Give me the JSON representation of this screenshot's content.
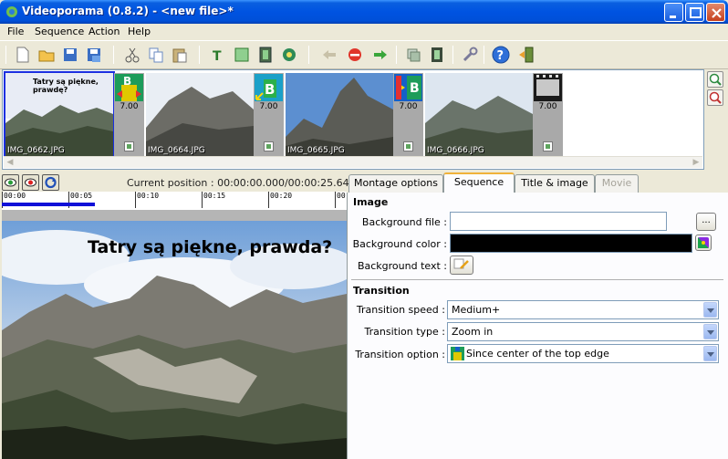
{
  "window": {
    "title": "Videoporama (0.8.2) - <new file>*"
  },
  "menu": {
    "file": "File",
    "sequence": "Sequence",
    "action": "Action",
    "help": "Help"
  },
  "toolbar": {
    "icons": [
      "new-file-icon",
      "open-folder-icon",
      "save-icon",
      "save-as-icon",
      "cut-icon",
      "copy-icon",
      "paste-icon",
      "add-text-icon",
      "add-image-icon",
      "add-video-icon",
      "add-sound-icon",
      "move-left-icon",
      "remove-icon",
      "move-right-icon",
      "copy-frame-icon",
      "film-icon",
      "settings-wrench-icon",
      "help-icon",
      "exit-icon"
    ]
  },
  "filmstrip": {
    "clips": [
      {
        "filename": "IMG_0662.JPG",
        "selected": true,
        "overlay": "Tatry są piękne, prawdę?"
      },
      {
        "filename": "IMG_0664.JPG",
        "selected": false
      },
      {
        "filename": "IMG_0665.JPG",
        "selected": false
      },
      {
        "filename": "IMG_0666.JPG",
        "selected": false
      }
    ],
    "transitions": [
      {
        "duration": "7.00"
      },
      {
        "duration": "7.00"
      },
      {
        "duration": "7.00"
      },
      {
        "duration": "7.00"
      }
    ]
  },
  "preview": {
    "current_position": "Current position : 00:00:00.000/00:00:25.640",
    "ruler_labels": [
      "00:00",
      "00:05",
      "00:10",
      "00:15",
      "00:20",
      "00:"
    ],
    "progress_fraction": 0.27,
    "overlay_text": "Tatry są piękne, prawda?"
  },
  "tabs": [
    {
      "label": "Montage options",
      "state": "normal"
    },
    {
      "label": "Sequence",
      "state": "active"
    },
    {
      "label": "Title & image",
      "state": "normal"
    },
    {
      "label": "Movie",
      "state": "disabled"
    }
  ],
  "sequence_tab": {
    "image_section": "Image",
    "background_file_label": "Background file :",
    "background_file_value": "",
    "browse_label": "...",
    "background_color_label": "Background color :",
    "background_color_value": "#000000",
    "background_text_label": "Background text :",
    "transition_section": "Transition",
    "transition_speed_label": "Transition speed :",
    "transition_speed_value": "Medium+",
    "transition_type_label": "Transition type :",
    "transition_type_value": "Zoom in",
    "transition_option_label": "Transition option :",
    "transition_option_value": "Since center of the top edge"
  },
  "colors": {
    "titlebar_blue": "#0053e1",
    "selection_blue": "#1b2fe0",
    "progress_blue": "#1010d8",
    "tab_accent": "#f0b23a"
  }
}
